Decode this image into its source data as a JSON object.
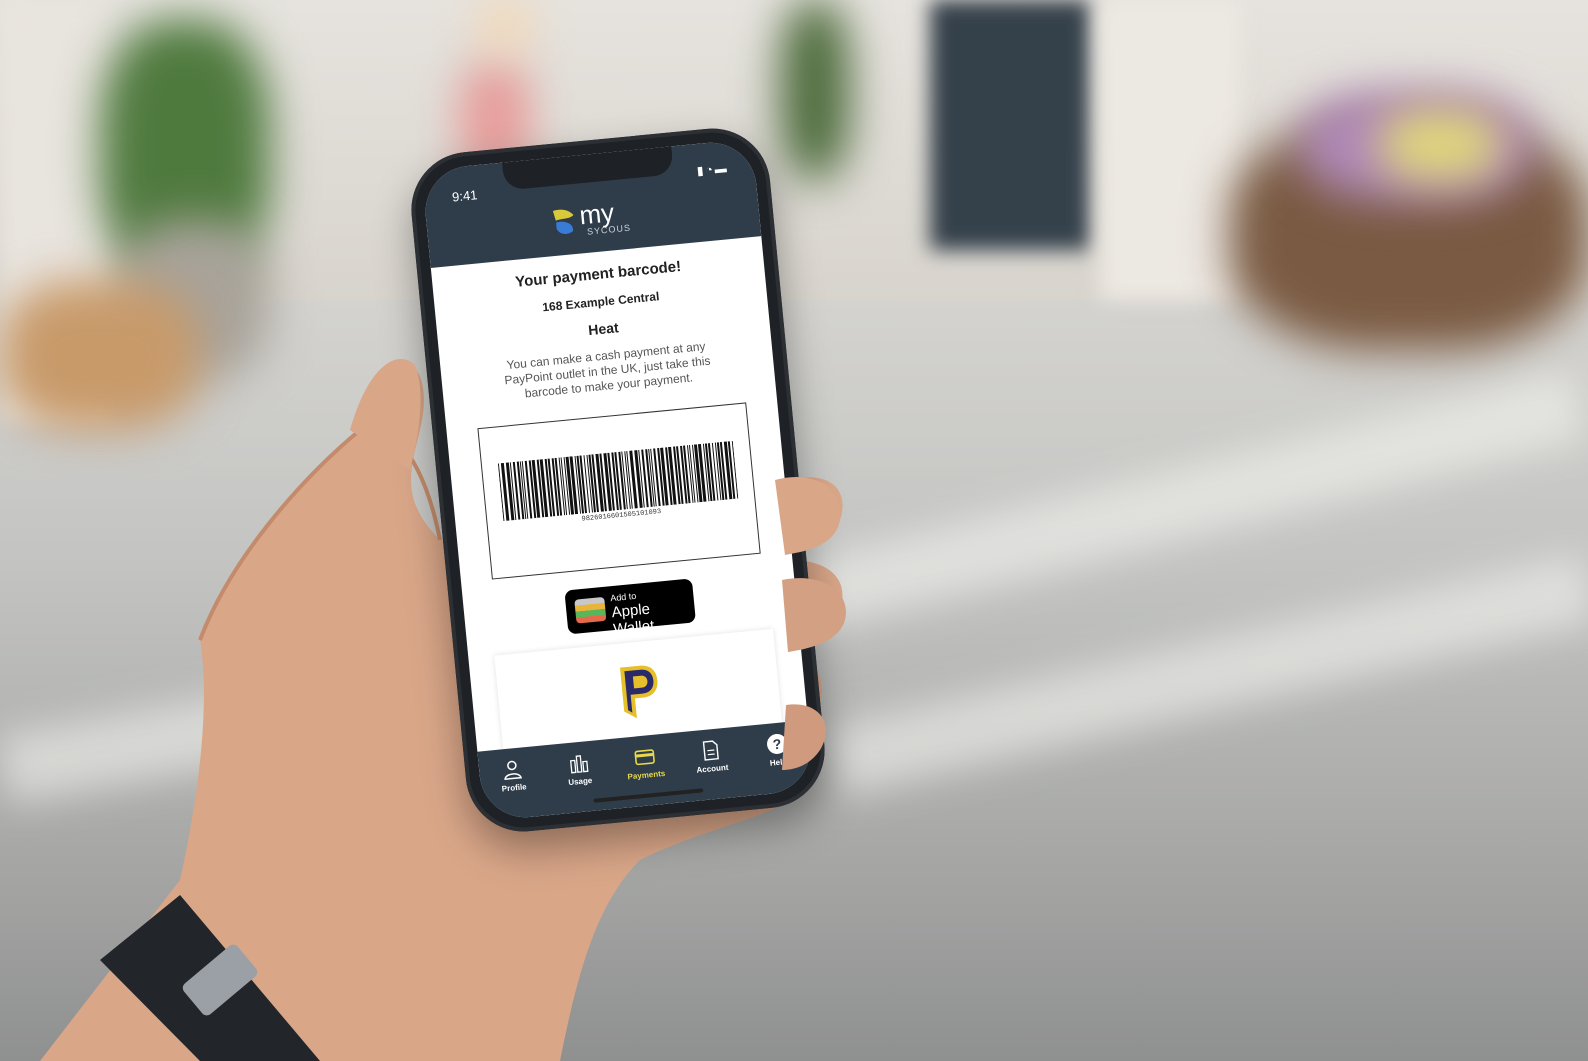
{
  "status": {
    "time": "9:41"
  },
  "logo": {
    "primary": "my",
    "secondary": "SYCOUS"
  },
  "payment": {
    "title": "Your payment barcode!",
    "address": "168 Example Central",
    "fuel": "Heat",
    "description": "You can make a cash payment at any PayPoint outlet in the UK, just take this barcode to make your payment.",
    "barcode_number": "9826016601505101093"
  },
  "wallet": {
    "small": "Add to",
    "big": "Apple Wallet"
  },
  "tabs": [
    {
      "label": "Profile",
      "icon": "person-icon"
    },
    {
      "label": "Usage",
      "icon": "bar-chart-icon"
    },
    {
      "label": "Payments",
      "icon": "card-icon",
      "active": true
    },
    {
      "label": "Account",
      "icon": "document-icon"
    },
    {
      "label": "Help",
      "icon": "help-icon"
    }
  ],
  "colors": {
    "header": "#2f3d4b",
    "active_tab": "#e6d84a",
    "brand_yellow": "#d9c93a",
    "brand_blue": "#3a7bd5"
  }
}
